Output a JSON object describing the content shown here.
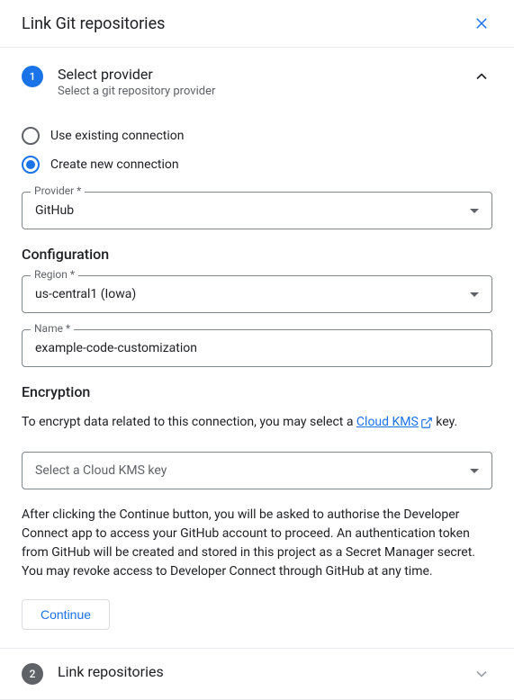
{
  "dialog": {
    "title": "Link Git repositories"
  },
  "step1": {
    "number": "1",
    "title": "Select provider",
    "subtitle": "Select a git repository provider",
    "radios": {
      "existing": "Use existing connection",
      "create": "Create new connection"
    },
    "provider": {
      "label": "Provider *",
      "value": "GitHub"
    },
    "configuration": {
      "heading": "Configuration",
      "region": {
        "label": "Region *",
        "value": "us-central1 (Iowa)"
      },
      "name": {
        "label": "Name *",
        "value": "example-code-customization"
      }
    },
    "encryption": {
      "heading": "Encryption",
      "text_before": "To encrypt data related to this connection, you may select a ",
      "link": "Cloud KMS",
      "text_after": " key.",
      "kms_placeholder": "Select a Cloud KMS key"
    },
    "info": "After clicking the Continue button, you will be asked to authorise the Developer Connect app to access your GitHub account to proceed. An authentication token from GitHub will be created and stored in this project as a Secret Manager secret. You may revoke access to Developer Connect through GitHub at any time.",
    "continue": "Continue"
  },
  "step2": {
    "number": "2",
    "title": "Link repositories"
  }
}
